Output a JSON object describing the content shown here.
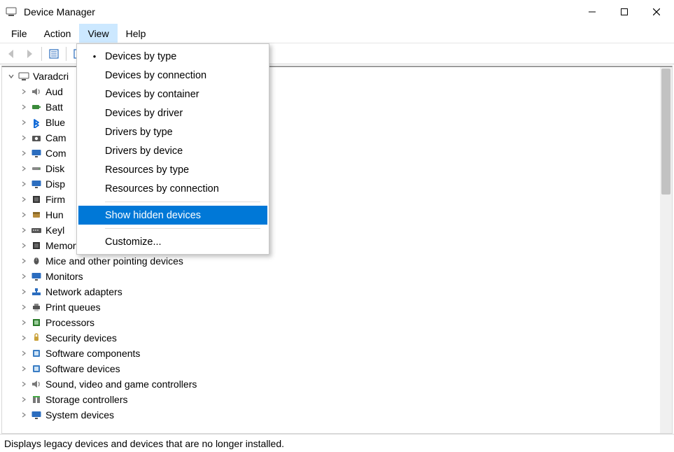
{
  "titlebar": {
    "title": "Device Manager"
  },
  "menubar": {
    "items": [
      {
        "label": "File",
        "active": false
      },
      {
        "label": "Action",
        "active": false
      },
      {
        "label": "View",
        "active": true
      },
      {
        "label": "Help",
        "active": false
      }
    ]
  },
  "viewmenu": {
    "items": [
      {
        "label": "Devices by type",
        "checked": true,
        "highlight": false
      },
      {
        "label": "Devices by connection",
        "checked": false,
        "highlight": false
      },
      {
        "label": "Devices by container",
        "checked": false,
        "highlight": false
      },
      {
        "label": "Devices by driver",
        "checked": false,
        "highlight": false
      },
      {
        "label": "Drivers by type",
        "checked": false,
        "highlight": false
      },
      {
        "label": "Drivers by device",
        "checked": false,
        "highlight": false
      },
      {
        "label": "Resources by type",
        "checked": false,
        "highlight": false
      },
      {
        "label": "Resources by connection",
        "checked": false,
        "highlight": false
      },
      {
        "label": "Show hidden devices",
        "checked": false,
        "highlight": true
      },
      {
        "label": "Customize...",
        "checked": false,
        "highlight": false
      }
    ]
  },
  "tree": {
    "root_label_visible": "Varadcri",
    "nodes": [
      {
        "label": "Aud",
        "icon": "speaker"
      },
      {
        "label": "Batt",
        "icon": "battery"
      },
      {
        "label": "Blue",
        "icon": "bluetooth"
      },
      {
        "label": "Cam",
        "icon": "camera"
      },
      {
        "label": "Com",
        "icon": "monitor"
      },
      {
        "label": "Disk",
        "icon": "hdd"
      },
      {
        "label": "Disp",
        "icon": "monitor"
      },
      {
        "label": "Firm",
        "icon": "chip"
      },
      {
        "label": "Hun",
        "icon": "hid"
      },
      {
        "label": "Keyl",
        "icon": "keyboard"
      },
      {
        "label": "Memory technology devices",
        "full_obscured": true,
        "icon": "chip"
      },
      {
        "label": "Mice and other pointing devices",
        "icon": "mouse"
      },
      {
        "label": "Monitors",
        "icon": "monitor"
      },
      {
        "label": "Network adapters",
        "icon": "network"
      },
      {
        "label": "Print queues",
        "icon": "printer"
      },
      {
        "label": "Processors",
        "icon": "cpu"
      },
      {
        "label": "Security devices",
        "icon": "security"
      },
      {
        "label": "Software components",
        "icon": "software"
      },
      {
        "label": "Software devices",
        "icon": "software"
      },
      {
        "label": "Sound, video and game controllers",
        "icon": "speaker"
      },
      {
        "label": "Storage controllers",
        "icon": "storage"
      },
      {
        "label": "System devices",
        "icon": "monitor"
      }
    ]
  },
  "statusbar": {
    "text": "Displays legacy devices and devices that are no longer installed."
  }
}
